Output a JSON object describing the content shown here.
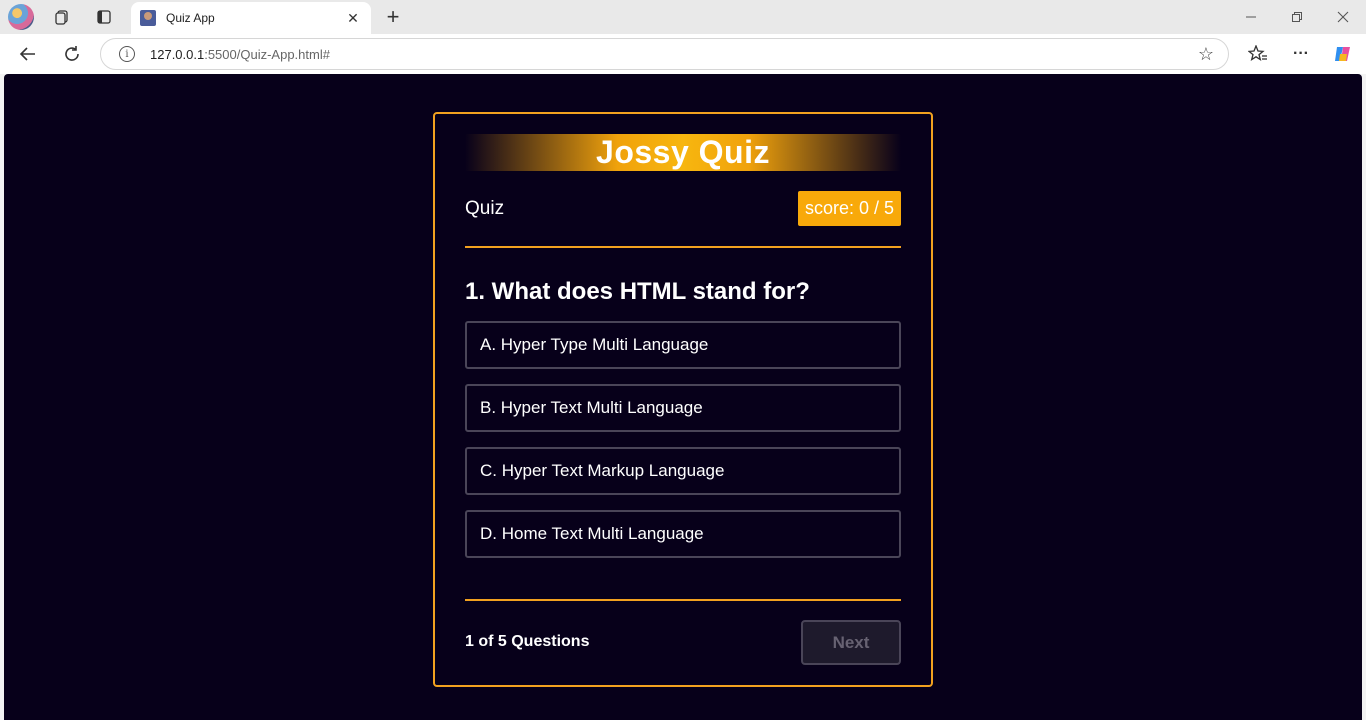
{
  "browser": {
    "tab_title": "Quiz App",
    "url_host": "127.0.0.1",
    "url_path": ":5500/Quiz-App.html#"
  },
  "quiz": {
    "brand": "Jossy Quiz",
    "section_label": "Quiz",
    "score_text": "score: 0 / 5",
    "question": "1. What does HTML stand for?",
    "options": [
      "A. Hyper Type Multi Language",
      "B. Hyper Text Multi Language",
      "C. Hyper Text Markup Language",
      "D. Home Text Multi Language"
    ],
    "progress_text": "1 of 5 Questions",
    "next_label": "Next"
  },
  "colors": {
    "accent": "#f2a11f",
    "background": "#07001a",
    "score_badge": "#f8a90a"
  }
}
